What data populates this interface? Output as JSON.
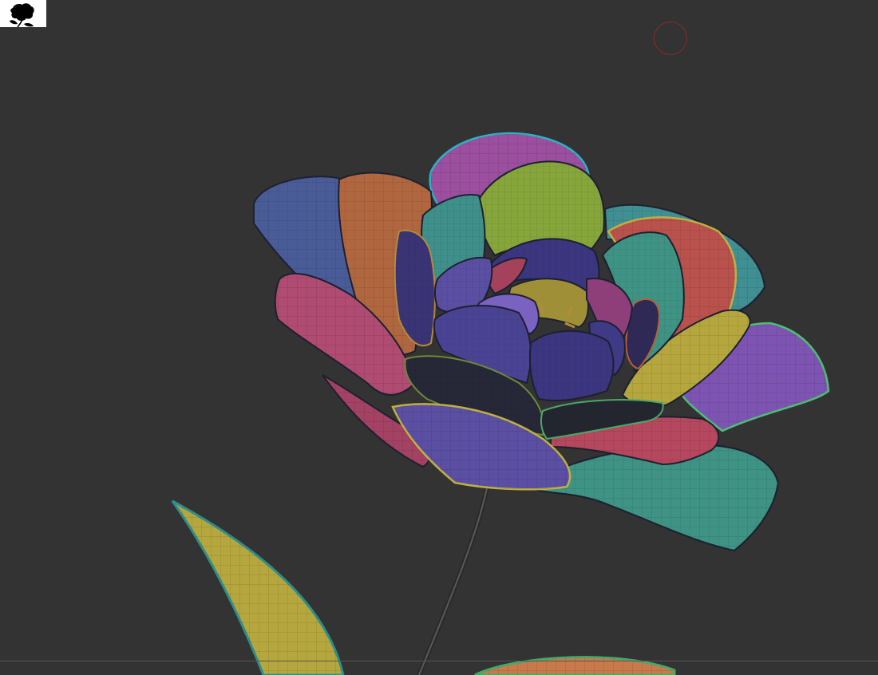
{
  "app": {
    "title": ""
  },
  "viewport": {
    "background_color": "#333333",
    "model": "flower-mesh-polygroups",
    "wireframe": true
  },
  "thumbnail": {
    "icon": "flower-silhouette-icon",
    "background_color": "#ffffff"
  },
  "brush_cursor": {
    "icon": "brush-circle-icon",
    "color": "#8a2a2a"
  },
  "polygroup_colors": {
    "blue": "#4a5c98",
    "orange": "#b0673f",
    "magenta": "#9b4f9e",
    "green": "#86a53a",
    "teal": "#3f9384",
    "red": "#b9524c",
    "purple": "#5a4fa2",
    "pink": "#b04b72",
    "yellow": "#b5a73e",
    "dark": "#262838",
    "violet": "#7e54b3"
  }
}
